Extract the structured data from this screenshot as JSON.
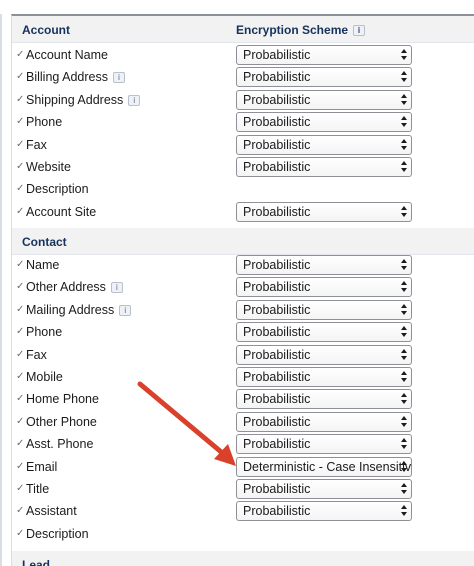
{
  "sections": [
    {
      "title": "Account",
      "column_header": "Encryption Scheme",
      "fields": [
        {
          "label": "Account Name",
          "info": false,
          "scheme": "Probabilistic"
        },
        {
          "label": "Billing Address",
          "info": true,
          "scheme": "Probabilistic"
        },
        {
          "label": "Shipping Address",
          "info": true,
          "scheme": "Probabilistic"
        },
        {
          "label": "Phone",
          "info": false,
          "scheme": "Probabilistic"
        },
        {
          "label": "Fax",
          "info": false,
          "scheme": "Probabilistic"
        },
        {
          "label": "Website",
          "info": false,
          "scheme": "Probabilistic"
        },
        {
          "label": "Description",
          "info": false,
          "scheme": ""
        },
        {
          "label": "Account Site",
          "info": false,
          "scheme": "Probabilistic"
        }
      ]
    },
    {
      "title": "Contact",
      "fields": [
        {
          "label": "Name",
          "info": false,
          "scheme": "Probabilistic"
        },
        {
          "label": "Other Address",
          "info": true,
          "scheme": "Probabilistic"
        },
        {
          "label": "Mailing Address",
          "info": true,
          "scheme": "Probabilistic"
        },
        {
          "label": "Phone",
          "info": false,
          "scheme": "Probabilistic"
        },
        {
          "label": "Fax",
          "info": false,
          "scheme": "Probabilistic"
        },
        {
          "label": "Mobile",
          "info": false,
          "scheme": "Probabilistic"
        },
        {
          "label": "Home Phone",
          "info": false,
          "scheme": "Probabilistic"
        },
        {
          "label": "Other Phone",
          "info": false,
          "scheme": "Probabilistic"
        },
        {
          "label": "Asst. Phone",
          "info": false,
          "scheme": "Probabilistic"
        },
        {
          "label": "Email",
          "info": false,
          "scheme": "Deterministic - Case Insensitive"
        },
        {
          "label": "Title",
          "info": false,
          "scheme": "Probabilistic"
        },
        {
          "label": "Assistant",
          "info": false,
          "scheme": "Probabilistic"
        },
        {
          "label": "Description",
          "info": false,
          "scheme": ""
        }
      ]
    },
    {
      "title": "Lead",
      "fields": []
    }
  ],
  "icons": {
    "checkbox": "checkmark-icon",
    "info": "info-icon",
    "select": "select-arrows-icon"
  },
  "colors": {
    "annotation_arrow": "#d9412a",
    "header_bg": "#f3f2f2"
  }
}
